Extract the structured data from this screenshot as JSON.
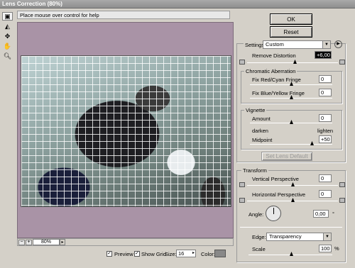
{
  "window": {
    "title": "Lens Correction (80%)"
  },
  "help": {
    "text": "Place mouse over control for help"
  },
  "buttons": {
    "ok": "OK",
    "reset": "Reset",
    "set_lens_default": "Set Lens Default"
  },
  "settings": {
    "label": "Settings:",
    "value": "Custom"
  },
  "remove_distortion": {
    "label": "Remove Distortion",
    "value": "+6,00",
    "level": 0.6
  },
  "chromatic": {
    "title": "Chromatic Aberration",
    "red_cyan_label": "Fix Red/Cyan Fringe",
    "red_cyan_value": "0",
    "blue_yellow_label": "Fix Blue/Yellow Fringe",
    "blue_yellow_value": "0"
  },
  "vignette": {
    "title": "Vignette",
    "amount_label": "Amount",
    "amount_value": "0",
    "darken": "darken",
    "lighten": "lighten",
    "midpoint_label": "Midpoint",
    "midpoint_value": "+50"
  },
  "transform": {
    "title": "Transform",
    "vertical_label": "Vertical Perspective",
    "vertical_value": "0",
    "horizontal_label": "Horizontal Perspective",
    "horizontal_value": "0",
    "angle_label": "Angle:",
    "angle_value": "0,00",
    "angle_unit": "°"
  },
  "edge": {
    "label": "Edge:",
    "value": "Transparency"
  },
  "scale": {
    "label": "Scale",
    "value": "100",
    "unit": "%"
  },
  "bottom": {
    "zoom": "80%",
    "preview_label": "Preview",
    "show_grid_label": "Show Grid",
    "size_label": "Size:",
    "size_value": "16",
    "color_label": "Color:"
  },
  "colors": {
    "canvas_bg": "#a993a6",
    "grid_color": "#808080"
  }
}
